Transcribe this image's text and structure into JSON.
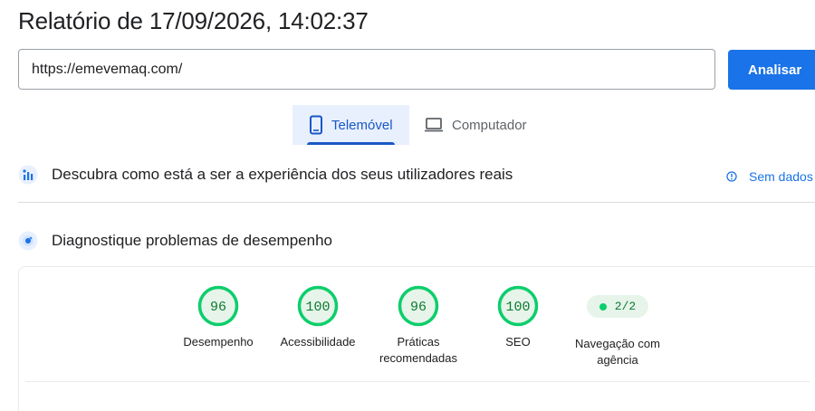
{
  "report": {
    "title": "Relatório de 17/09/2026, 14:02:37"
  },
  "search": {
    "url": "https://emevemaq.com/",
    "analyze_label": "Analisar"
  },
  "tabs": [
    {
      "label": "Telemóvel",
      "icon": "smartphone-icon",
      "active": true
    },
    {
      "label": "Computador",
      "icon": "laptop-icon",
      "active": false
    }
  ],
  "field_data": {
    "title": "Descubra como está a ser a experiência dos seus utilizadores reais",
    "status": "Sem dados",
    "icon": "users-chart-icon"
  },
  "diagnostics": {
    "title": "Diagnostique problemas de desempenho",
    "icon": "lighthouse-icon",
    "scores": [
      {
        "value": "96",
        "label": "Desempenho"
      },
      {
        "value": "100",
        "label": "Acessibilidade"
      },
      {
        "value": "96",
        "label": "Práticas recomendadas"
      },
      {
        "value": "100",
        "label": "SEO"
      }
    ],
    "agent_navigation": {
      "value": "2/2",
      "label": "Navegação com agência"
    }
  },
  "colors": {
    "accent": "#1a73e8",
    "pass": "#0cce6b",
    "pass_text": "#0c7a2e",
    "tab_bg": "#e8f0fe"
  }
}
